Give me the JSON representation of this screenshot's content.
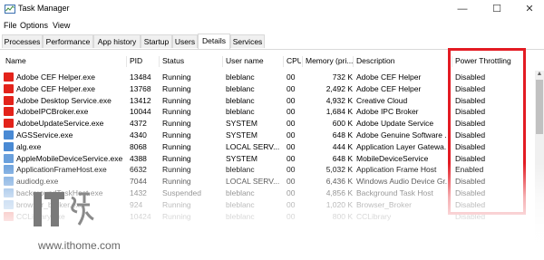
{
  "window": {
    "title": "Task Manager",
    "controls": [
      "—",
      "☐",
      "✕"
    ]
  },
  "menu": [
    "File",
    "Options",
    "View"
  ],
  "tabs": [
    {
      "label": "Processes",
      "active": false
    },
    {
      "label": "Performance",
      "active": false
    },
    {
      "label": "App history",
      "active": false
    },
    {
      "label": "Startup",
      "active": false
    },
    {
      "label": "Users",
      "active": false
    },
    {
      "label": "Details",
      "active": true
    },
    {
      "label": "Services",
      "active": false
    }
  ],
  "columns": [
    "Name",
    "PID",
    "Status",
    "User name",
    "CPU",
    "Memory (pri...",
    "Description",
    "Power Throttling"
  ],
  "rows": [
    {
      "name": "Adobe CEF Helper.exe",
      "pid": "13484",
      "status": "Running",
      "user": "bleblanc",
      "cpu": "00",
      "memory": "732 K",
      "description": "Adobe CEF Helper",
      "power": "Disabled",
      "icon_color": "#e3231b"
    },
    {
      "name": "Adobe CEF Helper.exe",
      "pid": "13768",
      "status": "Running",
      "user": "bleblanc",
      "cpu": "00",
      "memory": "2,492 K",
      "description": "Adobe CEF Helper",
      "power": "Disabled",
      "icon_color": "#e3231b"
    },
    {
      "name": "Adobe Desktop Service.exe",
      "pid": "13412",
      "status": "Running",
      "user": "bleblanc",
      "cpu": "00",
      "memory": "4,932 K",
      "description": "Creative Cloud",
      "power": "Disabled",
      "icon_color": "#e3231b"
    },
    {
      "name": "AdobeIPCBroker.exe",
      "pid": "10044",
      "status": "Running",
      "user": "bleblanc",
      "cpu": "00",
      "memory": "1,684 K",
      "description": "Adobe IPC Broker",
      "power": "Disabled",
      "icon_color": "#e3231b"
    },
    {
      "name": "AdobeUpdateService.exe",
      "pid": "4372",
      "status": "Running",
      "user": "SYSTEM",
      "cpu": "00",
      "memory": "600 K",
      "description": "Adobe Update Service",
      "power": "Disabled",
      "icon_color": "#e3231b"
    },
    {
      "name": "AGSService.exe",
      "pid": "4340",
      "status": "Running",
      "user": "SYSTEM",
      "cpu": "00",
      "memory": "648 K",
      "description": "Adobe Genuine Software ...",
      "power": "Disabled",
      "icon_color": "#4a8ad4"
    },
    {
      "name": "alg.exe",
      "pid": "8068",
      "status": "Running",
      "user": "LOCAL SERV...",
      "cpu": "00",
      "memory": "444 K",
      "description": "Application Layer Gatewa...",
      "power": "Disabled",
      "icon_color": "#4a8ad4"
    },
    {
      "name": "AppleMobileDeviceService.exe",
      "pid": "4388",
      "status": "Running",
      "user": "SYSTEM",
      "cpu": "00",
      "memory": "648 K",
      "description": "MobileDeviceService",
      "power": "Disabled",
      "icon_color": "#6aa0dc"
    },
    {
      "name": "ApplicationFrameHost.exe",
      "pid": "6632",
      "status": "Running",
      "user": "bleblanc",
      "cpu": "00",
      "memory": "5,032 K",
      "description": "Application Frame Host",
      "power": "Enabled",
      "icon_color": "#6aa0dc"
    },
    {
      "name": "audiodg.exe",
      "pid": "7044",
      "status": "Running",
      "user": "LOCAL SERV...",
      "cpu": "00",
      "memory": "6,436 K",
      "description": "Windows Audio Device Gr...",
      "power": "Disabled",
      "icon_color": "#6aa0dc"
    },
    {
      "name": "backgroundTaskHost.exe",
      "pid": "1432",
      "status": "Suspended",
      "user": "bleblanc",
      "cpu": "00",
      "memory": "4,856 K",
      "description": "Background Task Host",
      "power": "Disabled",
      "icon_color": "#6aa0dc"
    },
    {
      "name": "browser_broker.exe",
      "pid": "924",
      "status": "Running",
      "user": "bleblanc",
      "cpu": "00",
      "memory": "1,020 K",
      "description": "Browser_Broker",
      "power": "Disabled",
      "icon_color": "#6aa0dc"
    },
    {
      "name": "CCLibrary.exe",
      "pid": "10424",
      "status": "Running",
      "user": "bleblanc",
      "cpu": "00",
      "memory": "800 K",
      "description": "CCLibrary",
      "power": "Disabled",
      "icon_color": "#e3231b"
    }
  ],
  "watermark": {
    "url": "www.ithome.com"
  },
  "colors": {
    "highlight": "#e31b23",
    "tab_border": "#d9d9d9"
  }
}
